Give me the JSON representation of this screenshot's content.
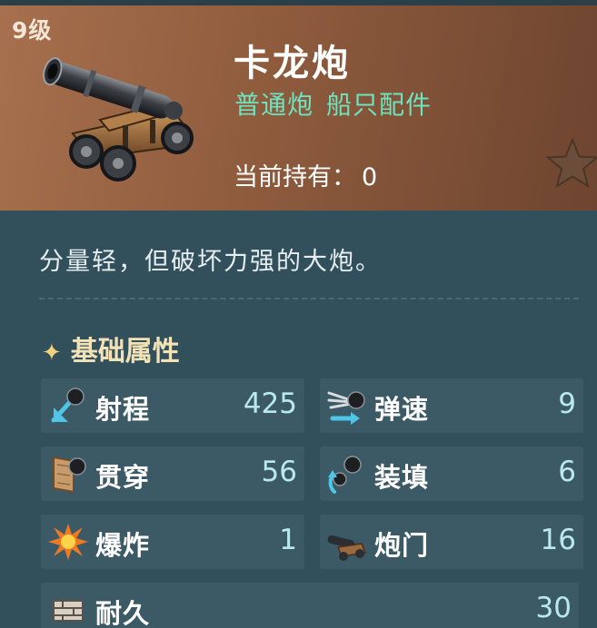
{
  "item": {
    "level": "9级",
    "name": "卡龙炮",
    "tags": [
      "普通炮",
      "船只配件"
    ],
    "owned_label": "当前持有：",
    "owned_value": "0",
    "description": "分量轻，但破坏力强的大炮。"
  },
  "attributes": {
    "title": "基础属性",
    "title_icon": "sparkle-icon",
    "stats": [
      {
        "label": "射程",
        "value": "425",
        "icon": "range-icon"
      },
      {
        "label": "弹速",
        "value": "9",
        "icon": "projectile-speed-icon"
      },
      {
        "label": "贯穿",
        "value": "56",
        "icon": "penetration-icon"
      },
      {
        "label": "装填",
        "value": "6",
        "icon": "reload-icon"
      },
      {
        "label": "爆炸",
        "value": "1",
        "icon": "explosion-icon"
      },
      {
        "label": "炮门",
        "value": "16",
        "icon": "gun-port-icon"
      },
      {
        "label": "耐久",
        "value": "30",
        "icon": "durability-icon"
      }
    ]
  },
  "colors": {
    "header_bg": "#9a6345",
    "body_bg": "#32505c",
    "tag_green": "#6fe2be",
    "value_cyan": "#b8e8f0",
    "section_gold": "#f3e2b6"
  }
}
